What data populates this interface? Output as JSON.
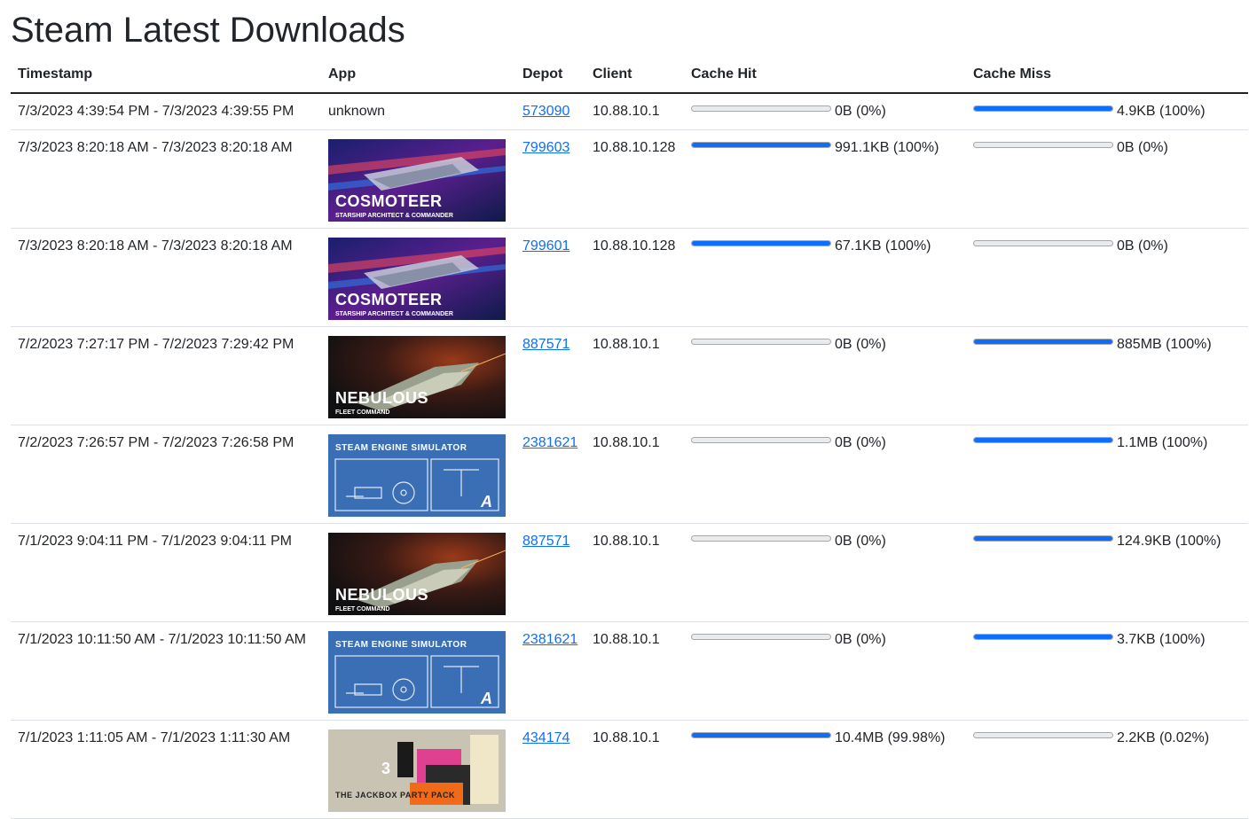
{
  "page": {
    "title": "Steam Latest Downloads"
  },
  "columns": [
    "Timestamp",
    "App",
    "Depot",
    "Client",
    "Cache Hit",
    "Cache Miss"
  ],
  "colors": {
    "bar_fill": "#0d6efd",
    "bar_track": "#e9ecef",
    "link": "#0d6efd"
  },
  "rows": [
    {
      "timestamp": "7/3/2023 4:39:54 PM - 7/3/2023 4:39:55 PM",
      "app_text": "unknown",
      "app_image": null,
      "depot": "573090",
      "client": "10.88.10.1",
      "hit_label": "0B (0%)",
      "hit_fraction": 0,
      "miss_label": "4.9KB (100%)",
      "miss_fraction": 1
    },
    {
      "timestamp": "7/3/2023 8:20:18 AM - 7/3/2023 8:20:18 AM",
      "app_text": "",
      "app_image": "cosmoteer",
      "app_logo": "COSMOTEER",
      "app_tagline": "STARSHIP ARCHITECT & COMMANDER",
      "depot": "799603",
      "client": "10.88.10.128",
      "hit_label": "991.1KB (100%)",
      "hit_fraction": 1,
      "miss_label": "0B (0%)",
      "miss_fraction": 0
    },
    {
      "timestamp": "7/3/2023 8:20:18 AM - 7/3/2023 8:20:18 AM",
      "app_text": "",
      "app_image": "cosmoteer",
      "app_logo": "COSMOTEER",
      "app_tagline": "STARSHIP ARCHITECT & COMMANDER",
      "depot": "799601",
      "client": "10.88.10.128",
      "hit_label": "67.1KB (100%)",
      "hit_fraction": 1,
      "miss_label": "0B (0%)",
      "miss_fraction": 0
    },
    {
      "timestamp": "7/2/2023 7:27:17 PM - 7/2/2023 7:29:42 PM",
      "app_text": "",
      "app_image": "nebulous",
      "app_logo": "NEBULOUS",
      "app_tagline": "FLEET COMMAND",
      "depot": "887571",
      "client": "10.88.10.1",
      "hit_label": "0B (0%)",
      "hit_fraction": 0,
      "miss_label": "885MB (100%)",
      "miss_fraction": 1
    },
    {
      "timestamp": "7/2/2023 7:26:57 PM - 7/2/2023 7:26:58 PM",
      "app_text": "",
      "app_image": "steam-engine",
      "app_logo": "STEAM ENGINE SIMULATOR",
      "app_tagline": "A",
      "depot": "2381621",
      "client": "10.88.10.1",
      "hit_label": "0B (0%)",
      "hit_fraction": 0,
      "miss_label": "1.1MB (100%)",
      "miss_fraction": 1
    },
    {
      "timestamp": "7/1/2023 9:04:11 PM - 7/1/2023 9:04:11 PM",
      "app_text": "",
      "app_image": "nebulous",
      "app_logo": "NEBULOUS",
      "app_tagline": "FLEET COMMAND",
      "depot": "887571",
      "client": "10.88.10.1",
      "hit_label": "0B (0%)",
      "hit_fraction": 0,
      "miss_label": "124.9KB (100%)",
      "miss_fraction": 1
    },
    {
      "timestamp": "7/1/2023 10:11:50 AM - 7/1/2023 10:11:50 AM",
      "app_text": "",
      "app_image": "steam-engine",
      "app_logo": "STEAM ENGINE SIMULATOR",
      "app_tagline": "A",
      "depot": "2381621",
      "client": "10.88.10.1",
      "hit_label": "0B (0%)",
      "hit_fraction": 0,
      "miss_label": "3.7KB (100%)",
      "miss_fraction": 1
    },
    {
      "timestamp": "7/1/2023 1:11:05 AM - 7/1/2023 1:11:30 AM",
      "app_text": "",
      "app_image": "jackbox",
      "app_logo": "THE JACKBOX PARTY PACK",
      "app_tagline": "3",
      "depot": "434174",
      "client": "10.88.10.1",
      "hit_label": "10.4MB (99.98%)",
      "hit_fraction": 0.9998,
      "miss_label": "2.2KB (0.02%)",
      "miss_fraction": 0.0002
    }
  ]
}
